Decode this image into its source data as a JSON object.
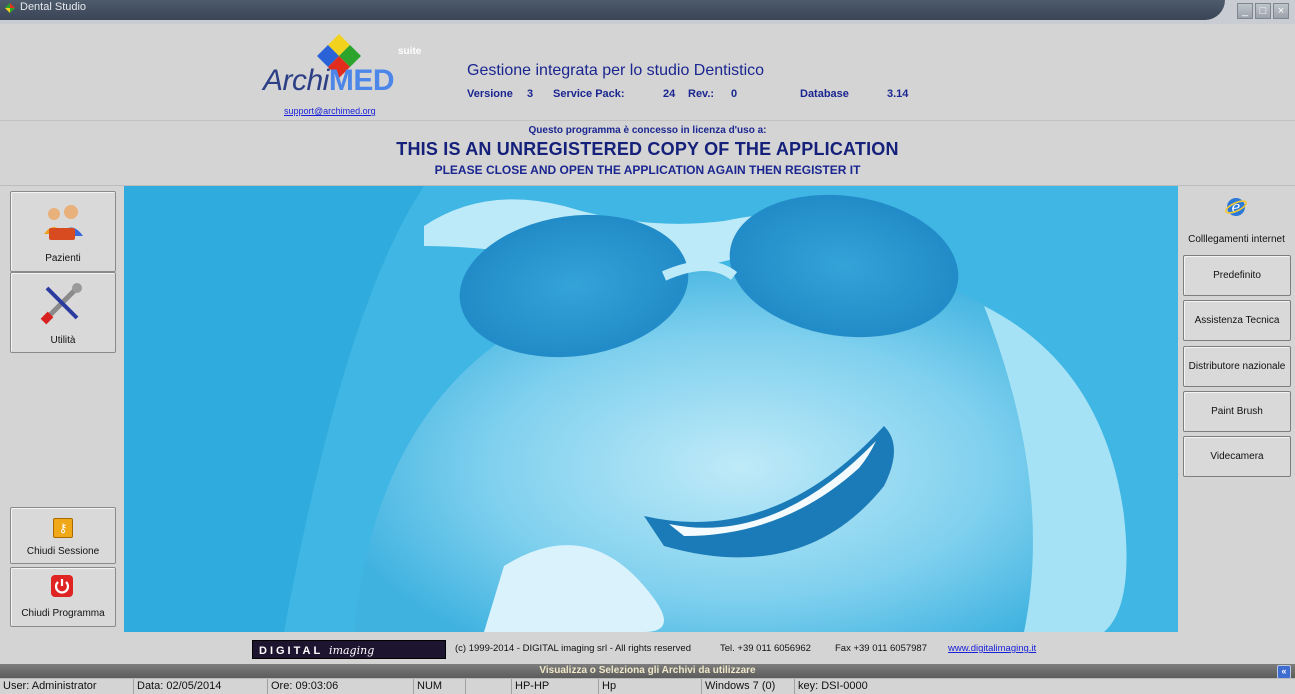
{
  "window": {
    "title": "Dental Studio",
    "controls": {
      "minimize": "_",
      "maximize": "□",
      "close": "×"
    }
  },
  "header": {
    "logo": {
      "prefix": "Archi",
      "main": "MED",
      "suffix": "suite"
    },
    "support_link": "support@archimed.org",
    "app_title": "Gestione integrata per lo studio Dentistico",
    "version_label": "Versione",
    "version_value": "3",
    "service_pack_label": "Service Pack:",
    "service_pack_value": "24",
    "rev_label": "Rev.:",
    "rev_value": "0",
    "database_label": "Database",
    "database_value": "3.14"
  },
  "license": {
    "line1": "Questo programma è concesso in licenza d'uso a:",
    "line2": "THIS IS AN UNREGISTERED COPY OF THE APPLICATION",
    "line3": "PLEASE CLOSE AND OPEN THE APPLICATION AGAIN THEN REGISTER IT"
  },
  "left_panel": {
    "buttons": [
      {
        "label": "Pazienti",
        "icon": "patients-icon"
      },
      {
        "label": "Utilità",
        "icon": "tools-icon"
      },
      {
        "label": "Chiudi Sessione",
        "icon": "key-icon"
      },
      {
        "label": "Chiudi Programma",
        "icon": "power-icon"
      }
    ]
  },
  "right_panel": {
    "internet_label": "Colllegamenti internet",
    "internet_icon": "internet-explorer-icon",
    "buttons": [
      {
        "label": "Predefinito"
      },
      {
        "label": "Assistenza Tecnica"
      },
      {
        "label": "Distributore nazionale"
      },
      {
        "label": "Paint Brush"
      },
      {
        "label": "Videcamera"
      }
    ]
  },
  "footer": {
    "logo_text": "DIGITAL",
    "logo_script": "imaging",
    "copyright": "(c) 1999-2014 - DIGITAL imaging srl - All rights reserved",
    "tel": "Tel. +39 011 6056962",
    "fax": "Fax +39 011 6057987",
    "website": "www.digitalimaging.it"
  },
  "archive_bar": {
    "label": "Visualizza o Seleziona gli Archivi da utilizzare",
    "toggle": "«"
  },
  "statusbar": {
    "user": "User: Administrator",
    "date": "Data: 02/05/2014",
    "time": "Ore: 09:03:06",
    "num": "NUM",
    "empty": "",
    "machine": "HP-HP",
    "host": "Hp",
    "os": "Windows 7 (0)",
    "key": "key: DSI-0000"
  },
  "colors": {
    "brand_navy": "#1a2690",
    "hero_cyan": "#43b9e6",
    "panel_gray": "#d4d4d4"
  }
}
